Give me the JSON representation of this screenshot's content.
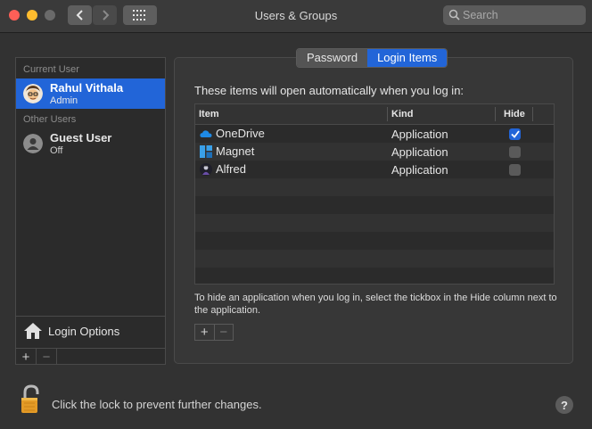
{
  "window": {
    "title": "Users & Groups"
  },
  "search": {
    "placeholder": "Search"
  },
  "sidebar": {
    "current_user_header": "Current User",
    "current_user": {
      "name": "Rahul Vithala",
      "role": "Admin"
    },
    "other_users_header": "Other Users",
    "other_users": [
      {
        "name": "Guest User",
        "role": "Off"
      }
    ],
    "login_options_label": "Login Options",
    "add_label": "+",
    "remove_label": "−"
  },
  "tabs": [
    {
      "label": "Password",
      "active": false
    },
    {
      "label": "Login Items",
      "active": true
    }
  ],
  "login_items": {
    "intro": "These items will open automatically when you log in:",
    "columns": {
      "item": "Item",
      "kind": "Kind",
      "hide": "Hide"
    },
    "rows": [
      {
        "name": "OneDrive",
        "icon": "onedrive-icon",
        "kind": "Application",
        "hide": true
      },
      {
        "name": "Magnet",
        "icon": "magnet-icon",
        "kind": "Application",
        "hide": false
      },
      {
        "name": "Alfred",
        "icon": "alfred-icon",
        "kind": "Application",
        "hide": false
      }
    ],
    "hint": "To hide an application when you log in, select the tickbox in the Hide column next to the application.",
    "add_label": "+",
    "remove_label": "−"
  },
  "footer": {
    "lock_text": "Click the lock to prevent further changes.",
    "help_label": "?"
  },
  "colors": {
    "accent": "#2265d8",
    "background": "#323232"
  }
}
